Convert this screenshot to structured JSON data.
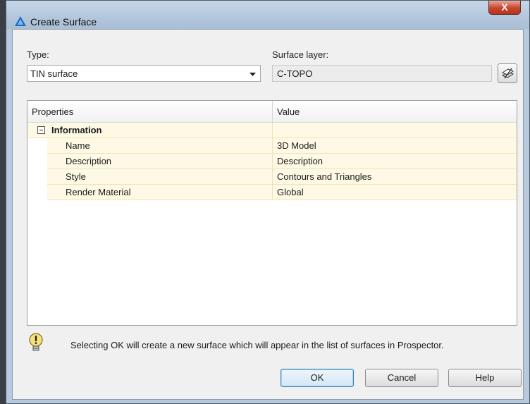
{
  "window": {
    "title": "Create Surface",
    "close_label": "X"
  },
  "type": {
    "label": "Type:",
    "value": "TIN surface"
  },
  "surface_layer": {
    "label": "Surface layer:",
    "value": "C-TOPO"
  },
  "grid": {
    "headers": {
      "properties": "Properties",
      "value": "Value"
    },
    "category": "Information",
    "rows": [
      {
        "name": "Name",
        "value": "3D Model"
      },
      {
        "name": "Description",
        "value": "Description"
      },
      {
        "name": "Style",
        "value": "Contours and Triangles"
      },
      {
        "name": "Render Material",
        "value": "Global"
      }
    ]
  },
  "info_message": "Selecting OK will create a new surface which will appear in the list of surfaces in Prospector.",
  "buttons": {
    "ok": "OK",
    "cancel": "Cancel",
    "help": "Help"
  },
  "icons": [
    "app-icon",
    "close-icon",
    "dropdown-arrow-icon",
    "layers-icon",
    "collapse-icon",
    "warning-bulb-icon"
  ]
}
